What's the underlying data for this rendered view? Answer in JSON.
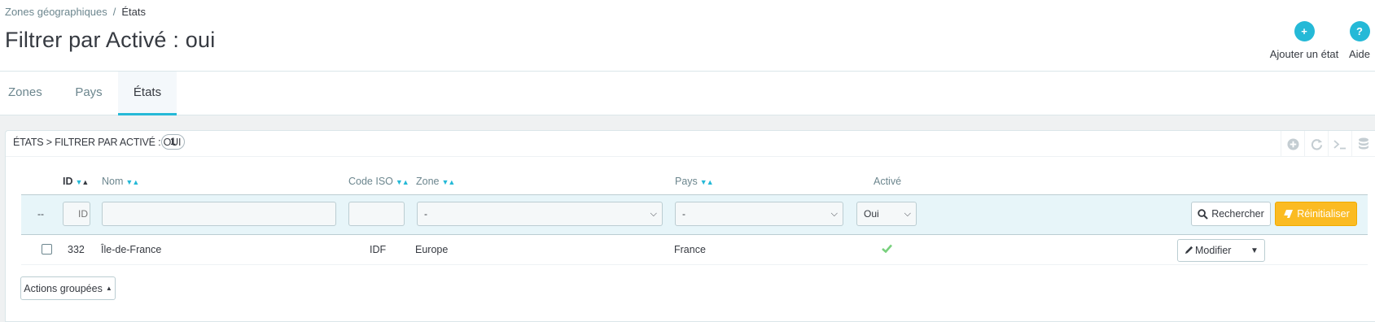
{
  "breadcrumb": {
    "parent": "Zones géographiques",
    "separator": "/",
    "current": "États"
  },
  "page_title": "Filtrer par Activé : oui",
  "toolbar": {
    "add_label": "Ajouter un état",
    "add_icon": "+",
    "help_label": "Aide",
    "help_icon": "?"
  },
  "tabs": [
    {
      "label": "Zones"
    },
    {
      "label": "Pays"
    },
    {
      "label": "États"
    }
  ],
  "panel": {
    "title": "États > Filtrer par Activé : oui",
    "count": "1",
    "tools": [
      "add-icon",
      "refresh-icon",
      "sql-query-icon",
      "database-icon"
    ]
  },
  "table": {
    "columns": {
      "id": "ID",
      "name": "Nom",
      "iso": "Code ISO",
      "zone": "Zone",
      "country": "Pays",
      "active": "Activé"
    },
    "filters": {
      "dash": "--",
      "id_placeholder": "ID",
      "zone_value": "-",
      "country_value": "-",
      "active_value": "Oui",
      "search_label": "Rechercher",
      "reset_label": "Réinitialiser"
    },
    "rows": [
      {
        "id": "332",
        "name": "Île-de-France",
        "iso": "IDF",
        "zone": "Europe",
        "country": "France",
        "active": true,
        "edit_label": "Modifier"
      }
    ]
  },
  "bulk_actions_label": "Actions groupées",
  "colors": {
    "accent": "#25b9d7",
    "warning": "#fbbb22",
    "success": "#78d07d"
  }
}
